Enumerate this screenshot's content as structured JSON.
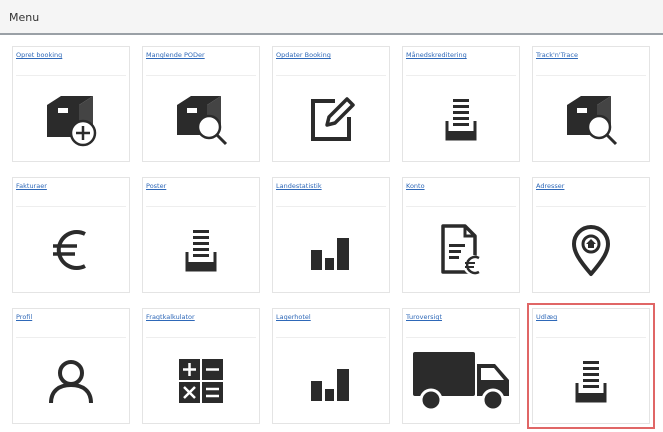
{
  "menu": {
    "title": "Menu"
  },
  "tiles": [
    {
      "label": "Opret booking",
      "icon": "box-add-icon"
    },
    {
      "label": "Manglende PODer",
      "icon": "box-search-icon"
    },
    {
      "label": "Opdater Booking",
      "icon": "edit-icon"
    },
    {
      "label": "Månedskreditering",
      "icon": "document-stack-icon"
    },
    {
      "label": "Track'n'Trace",
      "icon": "box-search-icon"
    },
    {
      "label": "Fakturaer",
      "icon": "euro-icon"
    },
    {
      "label": "Poster",
      "icon": "document-stack-icon"
    },
    {
      "label": "Landestatistik",
      "icon": "bar-chart-icon"
    },
    {
      "label": "Konto",
      "icon": "invoice-euro-icon"
    },
    {
      "label": "Adresser",
      "icon": "location-pin-icon"
    },
    {
      "label": "Profil",
      "icon": "user-icon"
    },
    {
      "label": "Fragtkalkulator",
      "icon": "calculator-icon"
    },
    {
      "label": "Lagerhotel",
      "icon": "bar-chart-icon"
    },
    {
      "label": "Turoversigt",
      "icon": "truck-icon"
    },
    {
      "label": "Udlæg",
      "icon": "document-stack-icon"
    }
  ],
  "colors": {
    "accent": "#2e68b8",
    "icon": "#2b2b2b",
    "highlight": "#e06666"
  }
}
